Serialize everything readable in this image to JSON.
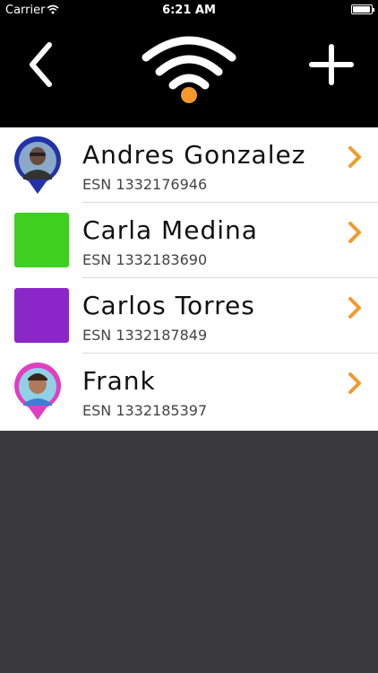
{
  "status_bar": {
    "carrier": "Carrier",
    "time": "6:21 AM"
  },
  "nav": {
    "back_icon": "chevron-left-icon",
    "logo_icon": "wifi-signal-icon",
    "add_icon": "plus-icon"
  },
  "colors": {
    "accent": "#f39a2b",
    "list_bg": "#ffffff",
    "page_bg": "#3a3a3d",
    "green": "#3fcf1f",
    "purple": "#8b26c9",
    "blue_pin": "#2233aa",
    "pink_pin": "#e23ec1"
  },
  "devices": [
    {
      "name": "Andres Gonzalez",
      "esn": "ESN 1332176946",
      "marker": "avatar-pin-blue"
    },
    {
      "name": "Carla Medina",
      "esn": "ESN 1332183690",
      "marker": "green-square"
    },
    {
      "name": "Carlos Torres",
      "esn": "ESN 1332187849",
      "marker": "purple-square"
    },
    {
      "name": "Frank",
      "esn": "ESN 1332185397",
      "marker": "avatar-pin-pink"
    }
  ]
}
